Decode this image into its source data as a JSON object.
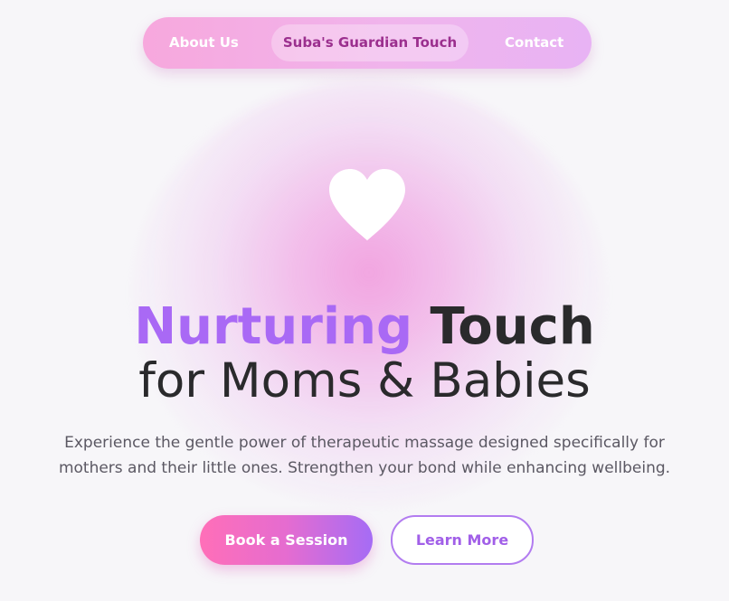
{
  "nav": {
    "about_label": "About Us",
    "brand_label": "Suba's Guardian Touch",
    "contact_label": "Contact"
  },
  "hero": {
    "icon": "heart-icon",
    "headline_accent": "Nurturing",
    "headline_dark": "Touch",
    "headline_line2": "for Moms & Babies",
    "description": "Experience the gentle power of therapeutic massage designed specifically for mothers and their little ones. Strengthen your bond while enhancing wellbeing."
  },
  "actions": {
    "primary_label": "Book a Session",
    "secondary_label": "Learn More"
  },
  "colors": {
    "accent_purple": "#a969f5",
    "accent_pink": "#ff6fb8",
    "brand_text": "#9b2f8e",
    "background": "#f7f6f9",
    "text_dark": "#2a2a2c"
  }
}
